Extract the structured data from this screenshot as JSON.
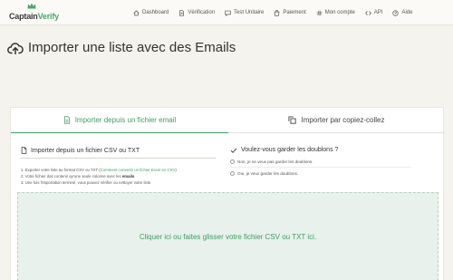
{
  "brand": {
    "part1": "Captain",
    "part2": "Verify"
  },
  "nav": {
    "items": [
      {
        "label": "Dashboard",
        "icon": "home-icon"
      },
      {
        "label": "Vérification",
        "icon": "document-icon"
      },
      {
        "label": "Test Unitaire",
        "icon": "chat-icon"
      },
      {
        "label": "Paiement",
        "icon": "shopping-bag-icon"
      },
      {
        "label": "Mon compte",
        "icon": "settings-icon"
      },
      {
        "label": "API",
        "icon": "code-icon"
      },
      {
        "label": "Aide",
        "icon": "help-icon"
      }
    ]
  },
  "page": {
    "title": "Importer une liste avec des Emails"
  },
  "tabs": {
    "email": "Importer depuis un fichier email",
    "paste": "Importer par copiez-collez"
  },
  "import_section": {
    "title": "Importer depuis un fichier CSV ou TXT",
    "step1_prefix": "1. Exporter votre liste au format CSV ou TXT (",
    "step1_link": "Comment convertir un fichier Excel en CSV",
    "step1_suffix": ")",
    "step2_prefix": "2. Votre fichier doit contenir qu'une seule colonne avec les ",
    "step2_bold": "emails",
    "step2_suffix": ".",
    "step3": "3. Une fois l'importation terminé, vous pouvez vérifier ou nettoyer votre liste."
  },
  "duplicates": {
    "title": "Voulez-vous garder les doublons ?",
    "option_no": "Non, je ne veux pas garder les doublons.",
    "option_yes": "Oui, je veux garder les doublons."
  },
  "dropzone": {
    "label": "Cliquer ici ou faites glisser votre fichier CSV ou TXT ici."
  },
  "colors": {
    "accent": "#3f9c62",
    "background": "#f4f3ee",
    "dropzone": "#e8f1eb"
  }
}
